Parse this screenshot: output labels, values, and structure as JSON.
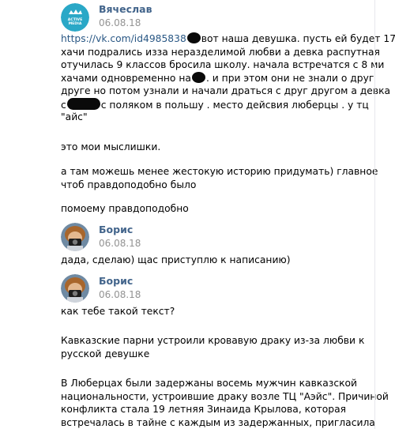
{
  "messages": [
    {
      "author": "Вячеслав",
      "date": "06.08.18",
      "avatar_text_top": "ACTIVE",
      "avatar_text_bottom": "MEDIA",
      "paragraphs": [
        {
          "lines": [
            [
              "https://vk.com/id4985838",
              "вот наша девушка. пусть ей будет 17."
            ],
            [
              "хачи подрались изза неразделимой любви а девка распутная"
            ],
            [
              "отучилась 9 классов бросила школу. начала встречатся с 8 ми"
            ],
            [
              "хачами одновременно на",
              ". и при этом они не знали о друг"
            ],
            [
              "друге но потом узнали и начали драться с друг другом а девка"
            ],
            [
              "с",
              "с поляком в польшу . место дейсвия люберцы . у тц"
            ],
            [
              "\"айс\""
            ]
          ]
        },
        {
          "lines": [
            [
              "это мои мыслишки."
            ]
          ]
        },
        {
          "lines": [
            [
              "а там можешь менее жестокую историю придумать) главное"
            ],
            [
              "чтоб правдоподобно было"
            ]
          ]
        },
        {
          "lines": [
            [
              "помоему правдоподобно"
            ]
          ]
        }
      ]
    },
    {
      "author": "Борис",
      "date": "06.08.18",
      "paragraphs": [
        {
          "lines": [
            [
              "дада, сделаю) щас приступлю к написанию)"
            ]
          ]
        }
      ]
    },
    {
      "author": "Борис",
      "date": "06.08.18",
      "paragraphs": [
        {
          "lines": [
            [
              "как тебе такой текст?"
            ]
          ]
        },
        {
          "lines": [
            [
              "Кавказские парни устроили кровавую драку из-за любви к"
            ],
            [
              "русской девушке"
            ]
          ]
        },
        {
          "lines": [
            [
              "В Люберцах были задержаны восемь мужчин кавказской"
            ],
            [
              "национальности, устроившие драку возле ТЦ \"Аэйс\". Причиной"
            ],
            [
              "конфликта стала 19 летняя Зинаида Крылова, которая"
            ],
            [
              "встречалась в тайне с каждым из задержанных, пригласила"
            ]
          ]
        }
      ]
    }
  ],
  "colors": {
    "name": "#42648b",
    "link": "#2a5885",
    "date": "#939393",
    "text": "#000000",
    "divider": "#e7e8ec"
  },
  "icons": {
    "avatar_1": "active-media-logo",
    "avatar_2": "boris-photo",
    "avatar_3": "boris-photo",
    "redaction": "black-scribble"
  }
}
